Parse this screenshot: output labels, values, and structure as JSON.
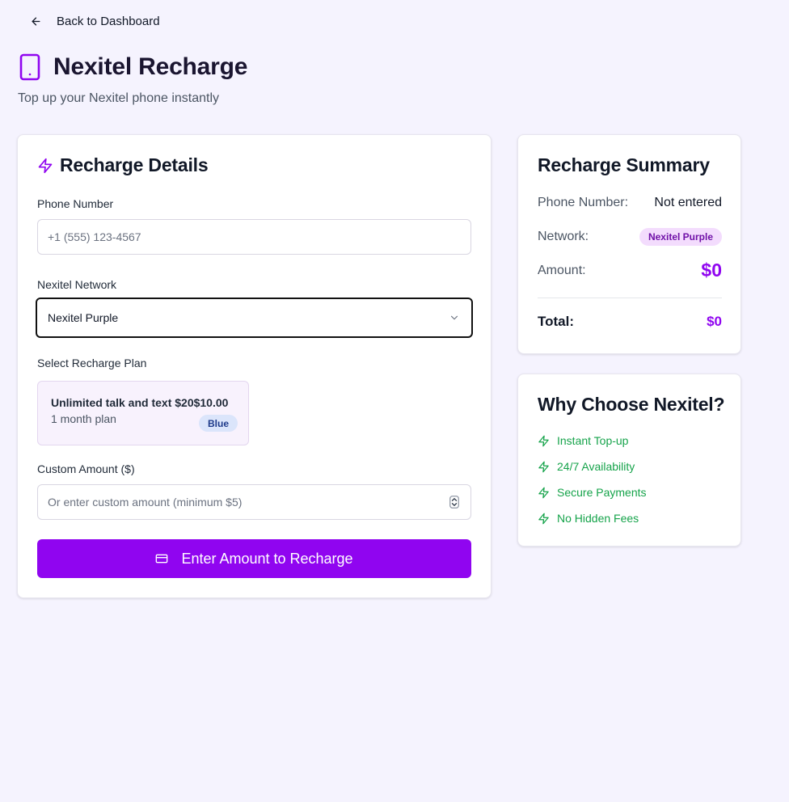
{
  "nav": {
    "back_label": "Back to Dashboard"
  },
  "header": {
    "title": "Nexitel Recharge",
    "subtitle": "Top up your Nexitel phone instantly"
  },
  "details": {
    "title": "Recharge Details",
    "phone_label": "Phone Number",
    "phone_value": "",
    "phone_placeholder": "+1 (555) 123-4567",
    "network_label": "Nexitel Network",
    "network_selected": "Nexitel Purple",
    "plan_label": "Select Recharge Plan",
    "plans": [
      {
        "name": "Unlimited talk and text $20",
        "price": "$10.00",
        "duration": "1 month plan",
        "badge": "Blue"
      }
    ],
    "custom_label": "Custom Amount ($)",
    "custom_value": "",
    "custom_placeholder": "Or enter custom amount (minimum $5)",
    "submit_label": "Enter Amount to Recharge"
  },
  "summary": {
    "title": "Recharge Summary",
    "phone_key": "Phone Number:",
    "phone_val": "Not entered",
    "network_key": "Network:",
    "network_val": "Nexitel Purple",
    "amount_key": "Amount:",
    "amount_val": "$0",
    "total_key": "Total:",
    "total_val": "$0"
  },
  "why": {
    "title": "Why Choose Nexitel?",
    "features": [
      "Instant Top-up",
      "24/7 Availability",
      "Secure Payments",
      "No Hidden Fees"
    ]
  },
  "colors": {
    "accent": "#9005f0",
    "background": "#f5f3fe",
    "success": "#15a34a",
    "plan_badge_bg": "#dbe5fb",
    "network_badge_bg": "#f3dcfd"
  },
  "icons": {
    "back": "arrow-left-icon",
    "brand": "smartphone-icon",
    "details": "zap-icon",
    "network_select": "chevron-down-icon",
    "submit": "credit-card-icon",
    "feature": "zap-icon"
  }
}
